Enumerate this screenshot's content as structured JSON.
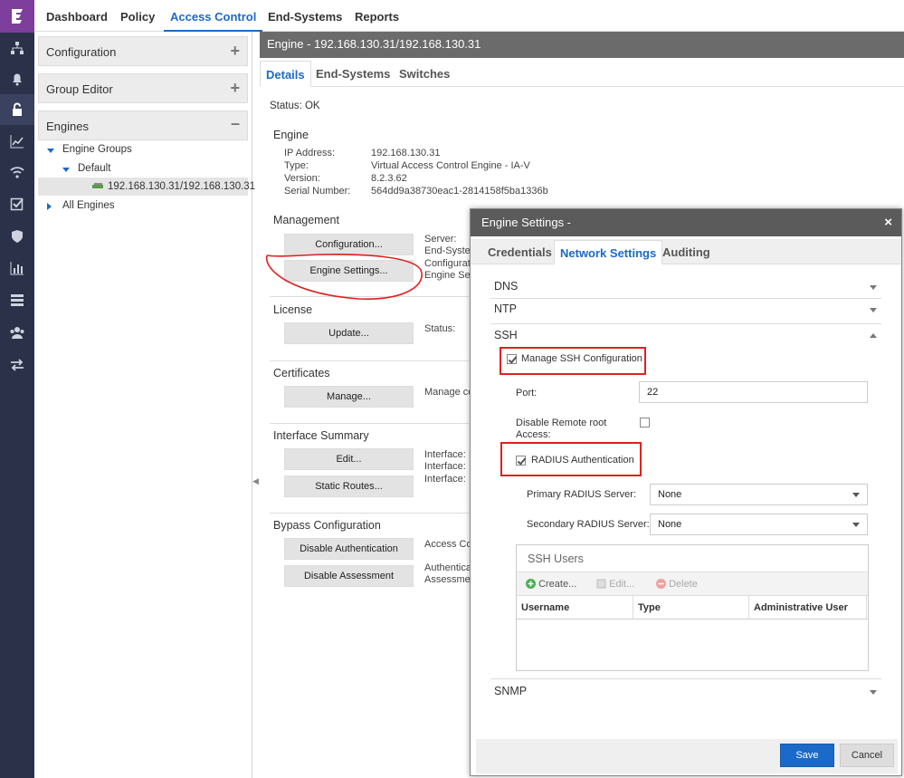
{
  "colors": {
    "accent": "#1b6ac9",
    "rail": "#2a3149",
    "logo_bg": "#7d3e9c",
    "annotation": "#e02020"
  },
  "rail": {
    "icons": [
      "logo-icon",
      "network-tree-icon",
      "bell-icon",
      "unlock-icon",
      "chart-line-icon",
      "wifi-icon",
      "checkbox-icon",
      "shield-icon",
      "bar-chart-icon",
      "server-icon",
      "users-icon",
      "arrows-swap-icon"
    ]
  },
  "topnav": {
    "tabs": [
      "Dashboard",
      "Policy",
      "Access Control",
      "End-Systems",
      "Reports"
    ],
    "active": "Access Control"
  },
  "left": {
    "configuration": "Configuration",
    "group_editor": "Group Editor",
    "engines": "Engines",
    "tree": {
      "engine_groups": "Engine Groups",
      "default": "Default",
      "engine": "192.168.130.31/192.168.130.31",
      "all_engines": "All Engines"
    }
  },
  "main": {
    "header": "Engine - 192.168.130.31/192.168.130.31",
    "tabs": [
      "Details",
      "End-Systems",
      "Switches"
    ],
    "status": "Status: OK",
    "engine": {
      "title": "Engine",
      "ip_label": "IP Address:",
      "ip": "192.168.130.31",
      "type_label": "Type:",
      "type": "Virtual Access Control Engine - IA-V",
      "version_label": "Version:",
      "version": "8.2.3.62",
      "serial_label": "Serial Number:",
      "serial": "564dd9a38730eac1-2814158f5ba1336b"
    },
    "management": {
      "title": "Management",
      "config_btn": "Configuration...",
      "settings_btn": "Engine Settings...",
      "right": [
        "Server:",
        "End-System",
        "Configurati",
        "Engine Set"
      ]
    },
    "license": {
      "title": "License",
      "btn": "Update...",
      "status": "Status:"
    },
    "certificates": {
      "title": "Certificates",
      "btn": "Manage...",
      "right": "Manage ce"
    },
    "interface": {
      "title": "Interface Summary",
      "edit": "Edit...",
      "routes": "Static Routes...",
      "right": [
        "Interface:",
        "Interface:",
        "Interface:"
      ]
    },
    "bypass": {
      "title": "Bypass Configuration",
      "disable_auth": "Disable Authentication",
      "disable_assess": "Disable Assessment",
      "right": [
        "Access Co",
        "Authentica",
        "Assessmen"
      ]
    }
  },
  "modal": {
    "title": "Engine Settings -",
    "close": "×",
    "tabs": [
      "Credentials",
      "Network Settings",
      "Auditing"
    ],
    "dns": "DNS",
    "ntp": "NTP",
    "ssh": "SSH",
    "manage_ssh": "Manage SSH Configuration",
    "port_label": "Port:",
    "port": "22",
    "disable_root": "Disable Remote root Access:",
    "radius": "RADIUS Authentication",
    "primary_label": "Primary RADIUS Server:",
    "primary": "None",
    "secondary_label": "Secondary RADIUS Server:",
    "secondary": "None",
    "ssh_users": {
      "title": "SSH Users",
      "create": "Create...",
      "edit": "Edit...",
      "delete": "Delete",
      "cols": [
        "Username",
        "Type",
        "Administrative User"
      ]
    },
    "snmp": "SNMP",
    "save": "Save",
    "cancel": "Cancel"
  }
}
